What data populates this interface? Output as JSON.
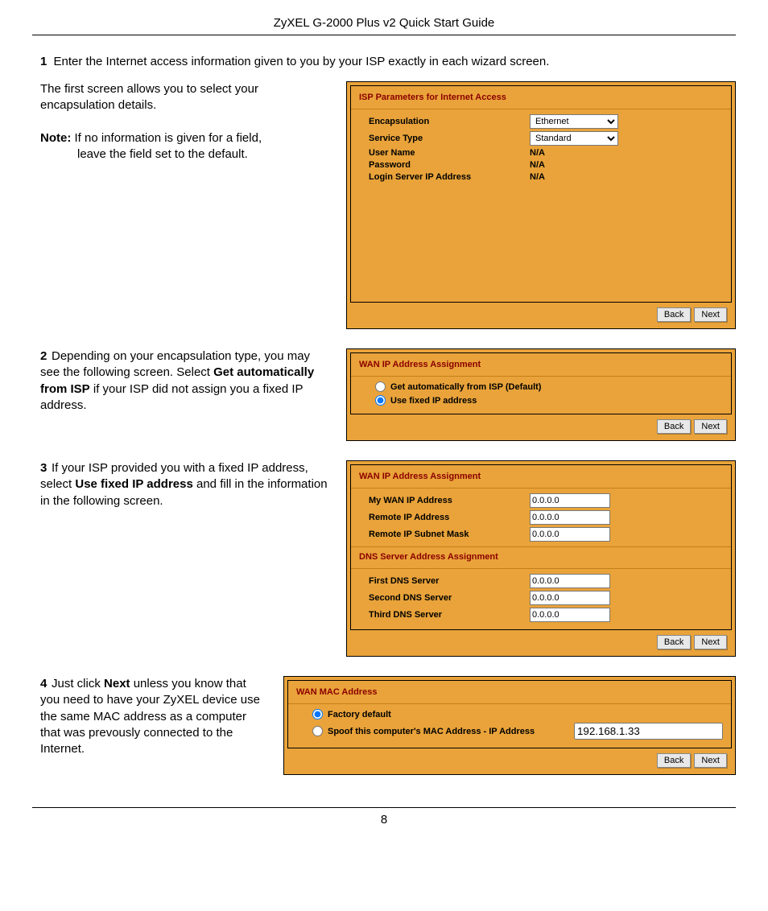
{
  "header": {
    "title": "ZyXEL G-2000 Plus v2 Quick Start Guide"
  },
  "footer": {
    "page": "8"
  },
  "step1": {
    "num": "1",
    "intro": "Enter the Internet access information given to you by your ISP exactly in each wizard screen.",
    "para1": "The first screen allows you to select your encapsulation details.",
    "note_label": "Note:",
    "note_text_a": "If no information is given for a field,",
    "note_text_b": "leave the field set to the default."
  },
  "panel1": {
    "title": "ISP Parameters for Internet Access",
    "rows": {
      "encapsulation": {
        "label": "Encapsulation",
        "value": "Ethernet"
      },
      "service_type": {
        "label": "Service Type",
        "value": "Standard"
      },
      "user_name": {
        "label": "User Name",
        "value": "N/A"
      },
      "password": {
        "label": "Password",
        "value": "N/A"
      },
      "login_server": {
        "label": "Login Server IP Address",
        "value": "N/A"
      }
    },
    "back": "Back",
    "next": "Next"
  },
  "step2": {
    "num": "2",
    "text_a": "Depending on your encapsulation type, you may see the following screen. Select ",
    "bold": "Get automatically from ISP",
    "text_b": " if your ISP did not assign you a fixed IP address."
  },
  "panel2": {
    "title": "WAN IP Address Assignment",
    "opt1": "Get automatically from ISP (Default)",
    "opt2": "Use fixed IP address",
    "back": "Back",
    "next": "Next"
  },
  "step3": {
    "num": "3",
    "text_a": "If your ISP provided you with a fixed IP address, select ",
    "bold": "Use fixed IP address",
    "text_b": " and fill in the information in the following screen."
  },
  "panel3": {
    "title1": "WAN IP Address Assignment",
    "my_wan_label": "My WAN IP Address",
    "my_wan_value": "0.0.0.0",
    "remote_ip_label": "Remote IP Address",
    "remote_ip_value": "0.0.0.0",
    "remote_mask_label": "Remote IP Subnet Mask",
    "remote_mask_value": "0.0.0.0",
    "title2": "DNS Server Address Assignment",
    "dns1_label": "First DNS Server",
    "dns1_value": "0.0.0.0",
    "dns2_label": "Second DNS Server",
    "dns2_value": "0.0.0.0",
    "dns3_label": "Third DNS Server",
    "dns3_value": "0.0.0.0",
    "back": "Back",
    "next": "Next"
  },
  "step4": {
    "num": "4",
    "text_a": "Just click ",
    "bold": "Next",
    "text_b": " unless you know that you need to have your ZyXEL device use the same MAC address as a computer that was prevously connected to the Internet."
  },
  "panel4": {
    "title": "WAN MAC Address",
    "opt1": "Factory default",
    "opt2": "Spoof this computer's MAC Address - IP Address",
    "ip_value": "192.168.1.33",
    "back": "Back",
    "next": "Next"
  }
}
